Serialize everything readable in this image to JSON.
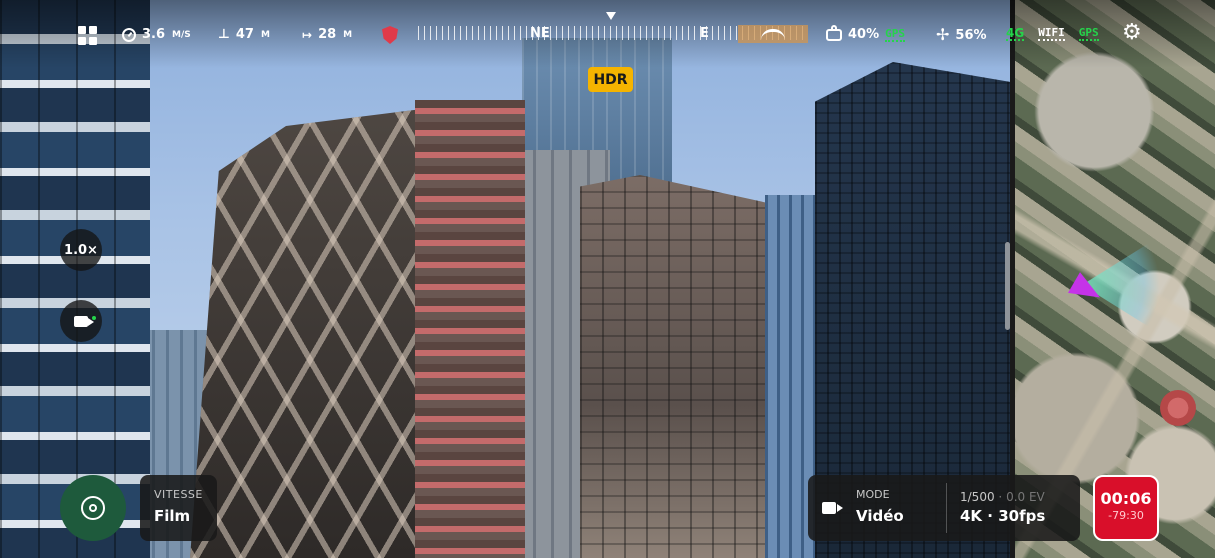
{
  "status_bar": {
    "speed": {
      "value": "3.6",
      "unit": "M/S",
      "icon": "speedometer-icon"
    },
    "altitude": {
      "value": "47",
      "unit": "M",
      "icon": "altitude-icon"
    },
    "distance": {
      "value": "28",
      "unit": "M",
      "icon": "distance-icon"
    },
    "geofence_icon": "shield-icon",
    "compass": {
      "labels": [
        "NE",
        "E"
      ]
    },
    "controller_battery": {
      "value": "40%",
      "gps_label": "GPS"
    },
    "drone_battery": {
      "value": "56%"
    },
    "network": {
      "cell": "4G",
      "wifi": "WIFI",
      "gps": "GPS"
    },
    "settings_icon": "gear-icon"
  },
  "hdr_badge": "HDR",
  "left_controls": {
    "zoom_label": "1.0×",
    "camera_switch_icon": "camera-switch-icon"
  },
  "bottom": {
    "speed_mode": {
      "label": "VITESSE",
      "value": "Film"
    },
    "mode": {
      "label": "MODE",
      "value": "Vidéo",
      "shutter": "1/500",
      "separator": "·",
      "ev": "0.0 EV",
      "resolution": "4K · 30fps"
    },
    "record": {
      "elapsed": "00:06",
      "remaining": "-79:30"
    }
  },
  "colors": {
    "accent_green": "#25d44b",
    "record_red": "#d90f2a",
    "hdr_yellow": "#f5b400",
    "takeoff_green": "#1e5a3c",
    "drone_marker": "#c533e8"
  }
}
